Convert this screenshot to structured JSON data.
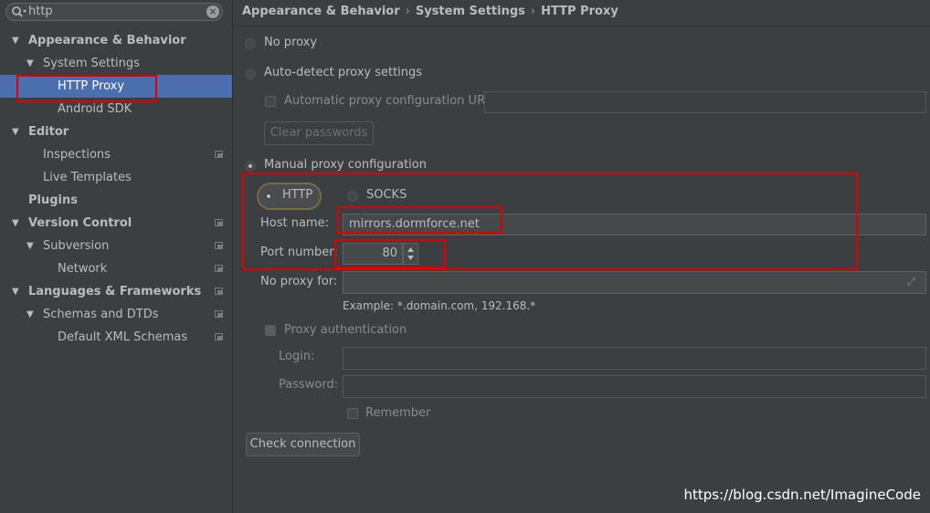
{
  "search": {
    "value": "http",
    "clear_glyph": "×"
  },
  "tree": {
    "appearance_behavior": "Appearance & Behavior",
    "system_settings": "System Settings",
    "http_proxy": "HTTP Proxy",
    "android_sdk": "Android SDK",
    "editor": "Editor",
    "inspections": "Inspections",
    "live_templates": "Live Templates",
    "plugins": "Plugins",
    "version_control": "Version Control",
    "subversion": "Subversion",
    "network": "Network",
    "languages_frameworks": "Languages & Frameworks",
    "schemas_dtds": "Schemas and DTDs",
    "default_xml_schemas": "Default XML Schemas"
  },
  "breadcrumb": {
    "part1": "Appearance & Behavior",
    "part2": "System Settings",
    "part3": "HTTP Proxy",
    "separator": "›"
  },
  "proxy": {
    "no_proxy": "No proxy",
    "auto_detect": "Auto-detect proxy settings",
    "auto_config_url_label": "Automatic proxy configuration URL:",
    "auto_config_url_value": "",
    "clear_passwords": "Clear passwords",
    "manual": "Manual proxy configuration",
    "selected_mode": "manual",
    "http": "HTTP",
    "socks": "SOCKS",
    "selected_protocol": "HTTP",
    "host_label": "Host name:",
    "host_value": "mirrors.dormforce.net",
    "port_label": "Port number:",
    "port_value": "80",
    "no_proxy_for_label": "No proxy for:",
    "no_proxy_for_value": "",
    "example": "Example: *.domain.com, 192.168.*",
    "proxy_auth": "Proxy authentication",
    "login_label": "Login:",
    "login_value": "",
    "password_label": "Password:",
    "password_value": "",
    "remember": "Remember",
    "check_connection": "Check connection"
  },
  "watermark": "https://blog.csdn.net/ImagineCode",
  "colors": {
    "background": "#3c3f41",
    "selection": "#4b6eaf",
    "annotation_red": "#e00000"
  }
}
